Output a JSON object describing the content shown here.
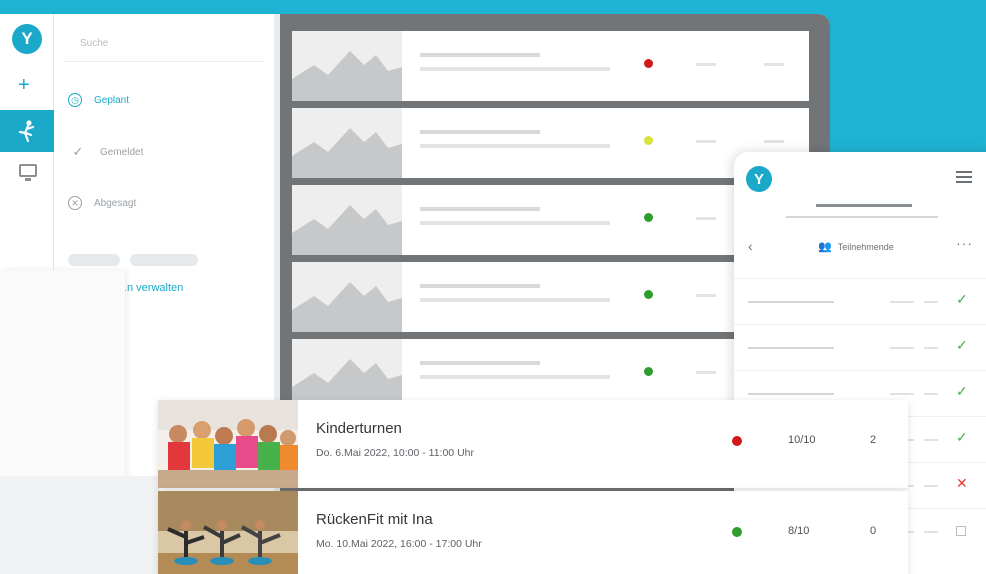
{
  "colors": {
    "brand": "#1aa9c9",
    "status_red": "#d0191b",
    "status_yellow": "#d8e23a",
    "status_green": "#2e9d2e"
  },
  "sidebar": {
    "search_placeholder": "Suche",
    "items": [
      {
        "label": "Geplant",
        "icon": "clock-icon",
        "active": true
      },
      {
        "label": "Gemeldet",
        "icon": "check-icon",
        "active": false
      },
      {
        "label": "Abgesagt",
        "icon": "x-circle-icon",
        "active": false
      }
    ],
    "manage_link": "…n verwalten"
  },
  "background_rows": [
    {
      "status": "red"
    },
    {
      "status": "yellow"
    },
    {
      "status": "green"
    },
    {
      "status": "green"
    },
    {
      "status": "green"
    }
  ],
  "mobile": {
    "nav_label": "Teilnehmende",
    "marks": [
      "check",
      "check",
      "check",
      "check",
      "x",
      "box"
    ]
  },
  "events": [
    {
      "title": "Kinderturnen",
      "date": "Do. 6.Mai 2022, 10:00 - 11:00 Uhr",
      "status": "red",
      "participants": "10/10",
      "waitlist": "2"
    },
    {
      "title": "RückenFit mit Ina",
      "date": "Mo. 10.Mai 2022, 16:00 - 17:00 Uhr",
      "status": "green",
      "participants": "8/10",
      "waitlist": "0"
    }
  ]
}
